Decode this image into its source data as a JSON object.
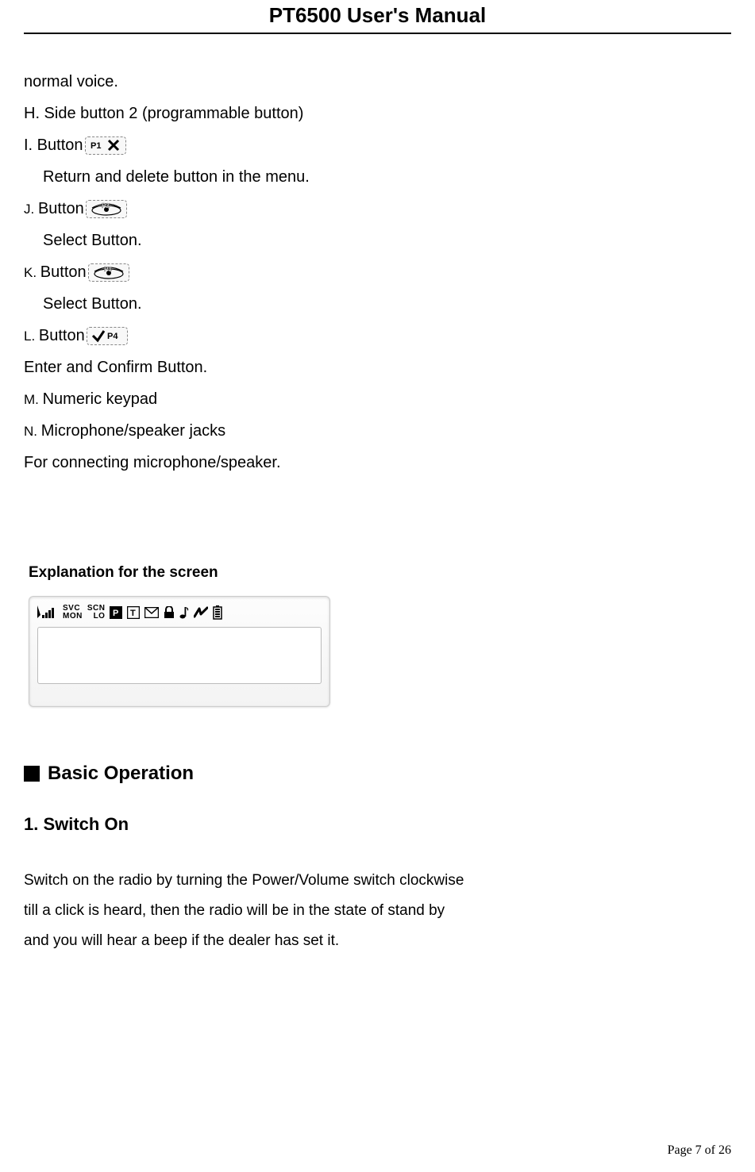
{
  "header": {
    "title": "PT6500 User's Manual"
  },
  "lines": {
    "l1": "normal voice.",
    "l2": "H. Side button 2 (programmable button)",
    "i_prefix": "I. Button",
    "i_desc": "Return and delete button in the menu.",
    "j_prefix_small": "J. ",
    "j_prefix_rest": "Button",
    "j_desc": "Select Button.",
    "k_prefix_small": "K. ",
    "k_prefix_rest": "Button",
    "k_desc": "Select Button.",
    "l_prefix_small": "L. ",
    "l_prefix_rest": "Button",
    "l_desc": "Enter and Confirm Button.",
    "m_small": "M. ",
    "m_rest": "Numeric keypad",
    "n_small": "N. ",
    "n_rest": "Microphone/speaker jacks",
    "n_desc": "For connecting microphone/speaker."
  },
  "screen": {
    "label": "Explanation for the screen",
    "stack1_top": "SVC",
    "stack1_bot": "MON",
    "stack2_top": "SCN",
    "stack2_bot": "LO"
  },
  "icons": {
    "p1": "P1",
    "p2": "P2",
    "p3": "P3",
    "p4": "P4",
    "lcd_p": "P",
    "lcd_t": "T"
  },
  "section": {
    "title": "Basic Operation",
    "sub": "1. Switch On"
  },
  "paragraph": {
    "p1": "Switch on the radio by turning the Power/Volume switch clockwise",
    "p2": "till a click is heard, then the radio will be in the state of stand by",
    "p3": "and you will hear a beep if the dealer has set it."
  },
  "footer": {
    "text": "Page 7 of 26"
  }
}
